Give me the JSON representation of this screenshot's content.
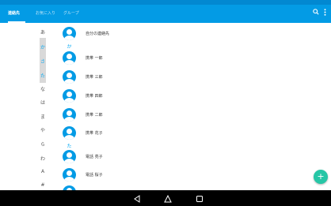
{
  "appbar": {
    "tabs": [
      {
        "label": "連絡先",
        "active": true
      },
      {
        "label": "お気に入り",
        "active": false
      },
      {
        "label": "グループ",
        "active": false
      }
    ],
    "search_icon": "search-icon",
    "menu_icon": "more-vert-icon"
  },
  "index_letters": [
    "あ",
    "か",
    "さ",
    "た",
    "な",
    "は",
    "ま",
    "や",
    "ら",
    "わ",
    "A",
    "#"
  ],
  "index_selected": [
    "か",
    "さ",
    "た"
  ],
  "contacts": {
    "me": "自分の連絡先",
    "section_ka": "か",
    "ka": [
      "携帯 一郎",
      "携帯 三郎",
      "携帯 四郎",
      "携帯 二郎",
      "携帯 花子"
    ],
    "section_ta": "た",
    "ta": [
      "電話 亮子",
      "電話 桜子"
    ]
  },
  "fab": {
    "label": "+"
  },
  "colors": {
    "accent": "#039be5",
    "status_bar": "#0288d1",
    "fab": "#26c6a6",
    "index_selected": "#03a9f4"
  },
  "navbar": {
    "icons": [
      "back-icon",
      "home-icon",
      "recents-icon"
    ]
  }
}
